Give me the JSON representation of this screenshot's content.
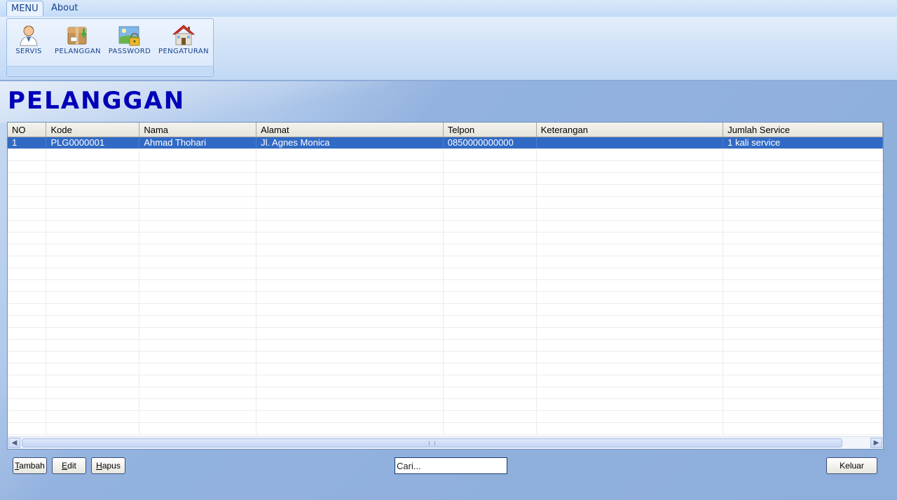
{
  "menu": {
    "tabs": [
      {
        "label": "MENU",
        "active": true
      },
      {
        "label": "About",
        "active": false
      }
    ]
  },
  "ribbon": {
    "buttons": [
      {
        "label": "SERVIS",
        "icon": "user-person-icon"
      },
      {
        "label": "PELANGGAN",
        "icon": "package-box-icon"
      },
      {
        "label": "PASSWORD",
        "icon": "lock-landscape-icon"
      },
      {
        "label": "PENGATURAN",
        "icon": "house-icon"
      }
    ]
  },
  "page": {
    "title": "PELANGGAN"
  },
  "grid": {
    "columns": [
      "NO",
      "Kode",
      "Nama",
      "Alamat",
      "Telpon",
      "Keterangan",
      "Jumlah Service"
    ],
    "rows": [
      [
        "1",
        "PLG0000001",
        "Ahmad Thohari",
        "Jl. Agnes Monica",
        "0850000000000",
        "",
        "1 kali service"
      ]
    ],
    "selected_row": 0
  },
  "actions": {
    "tambah": {
      "key": "T",
      "rest": "ambah"
    },
    "edit": {
      "key": "E",
      "rest": "dit"
    },
    "hapus": {
      "key": "H",
      "rest": "apus"
    },
    "keluar": "Keluar"
  },
  "search": {
    "placeholder": "Cari..."
  },
  "colors": {
    "title": "#0000b8",
    "selection": "#316ac5",
    "background": "#8eaedb"
  }
}
